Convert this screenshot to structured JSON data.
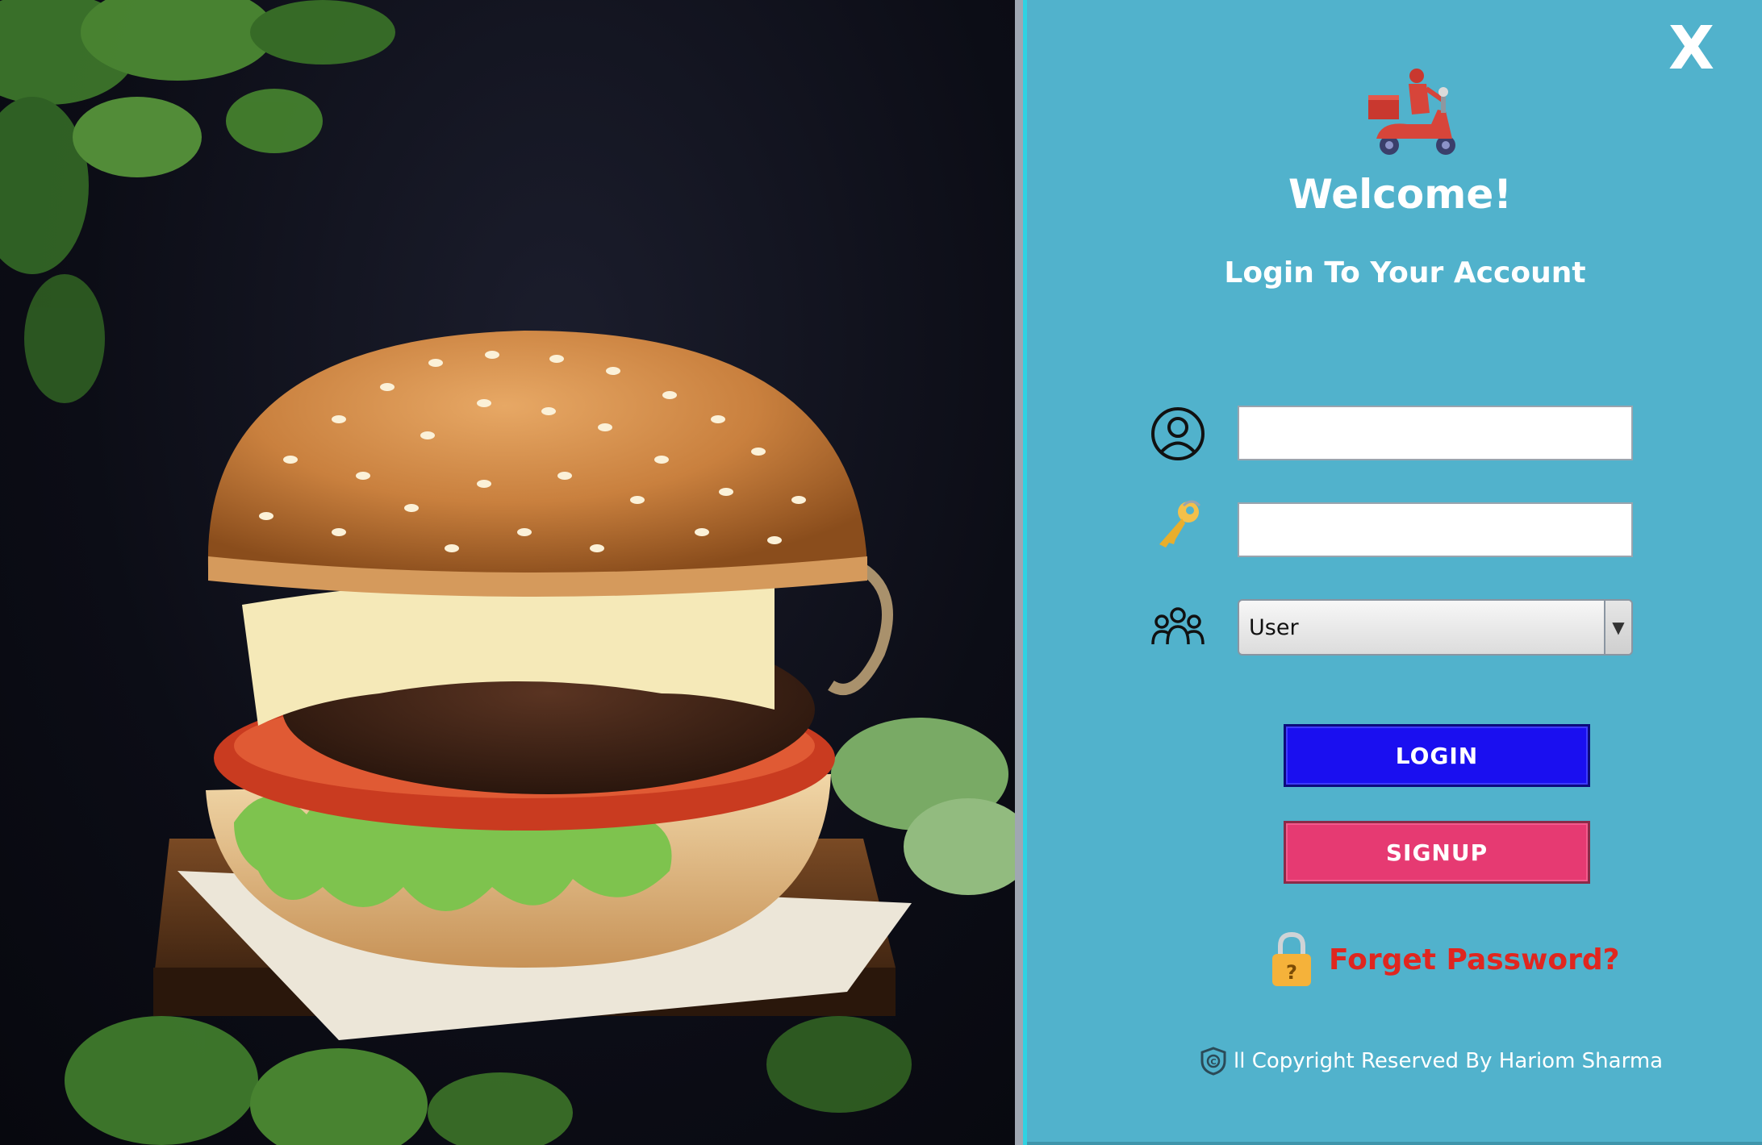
{
  "window": {
    "close_label": "X"
  },
  "photo": {
    "subject": "burger-photo"
  },
  "login": {
    "welcome": "Welcome!",
    "subtitle": "Login To Your Account",
    "username_value": "",
    "password_value": "",
    "role_selected": "User",
    "login_button": "LOGIN",
    "signup_button": "SIGNUP",
    "forgot_password": "Forget Password?",
    "copyright": "ll Copyright Reserved By Hariom Sharma"
  },
  "icons": {
    "logo": "delivery-scooter-icon",
    "username": "user-circle-icon",
    "password": "key-icon",
    "role": "group-icon",
    "forgot": "padlock-question-icon",
    "copyright": "shield-copyright-icon"
  },
  "colors": {
    "panel_background": "#51b2cc",
    "login_button": "#1a0ff0",
    "signup_button": "#e63a72",
    "forgot_text": "#e0261f"
  }
}
